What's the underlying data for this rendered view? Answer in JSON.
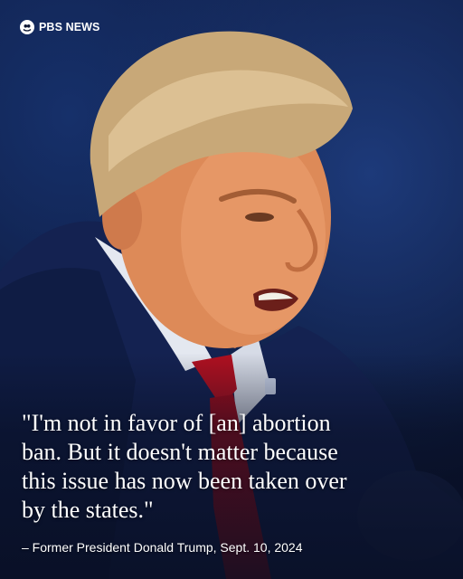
{
  "brand": {
    "name": "PBS NEWS",
    "logo_icon": "pbs-logo-icon"
  },
  "photo": {
    "description_icon": "speaker-portrait"
  },
  "quote": {
    "lines": [
      "\"I'm not in favor of [an] abortion",
      "ban. But it doesn't matter because",
      "this issue has now been taken over",
      "by the states.\""
    ],
    "attribution": "– Former President Donald Trump, Sept. 10, 2024"
  },
  "colors": {
    "background": "#0c1633",
    "text": "#ffffff",
    "tie": "#b01020"
  }
}
